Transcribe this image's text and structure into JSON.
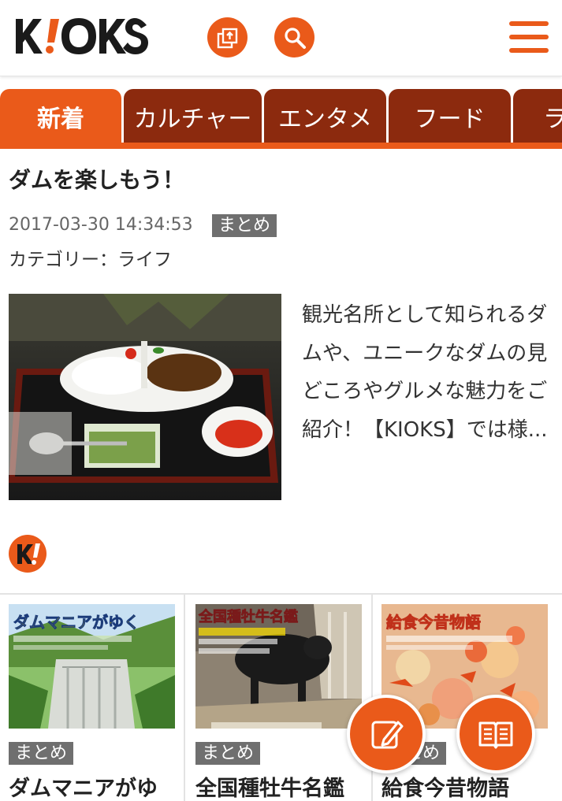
{
  "header": {
    "logo_text": "KIOKS",
    "share_icon": "share-icon",
    "search_icon": "search-icon",
    "menu_icon": "hamburger-menu-icon"
  },
  "colors": {
    "accent": "#ea5a1a",
    "tab_inactive": "#8c2a0e",
    "badge": "#6f6f6f"
  },
  "tabs": [
    {
      "label": "新着",
      "active": true
    },
    {
      "label": "カルチャー",
      "active": false
    },
    {
      "label": "エンタメ",
      "active": false
    },
    {
      "label": "フード",
      "active": false
    },
    {
      "label": "ラ",
      "active": false
    }
  ],
  "article": {
    "title": "ダムを楽しもう！",
    "date": "2017-03-30 14:34:53",
    "badge": "まとめ",
    "category": "カテゴリー：ライフ",
    "excerpt": "観光名所として知られるダムや、ユニークなダムの見どころやグルメな魅力をご紹介！【KIOKS】では様..."
  },
  "cards": [
    {
      "image_caption": "ダムマニアがゆく",
      "badge": "まとめ",
      "title": "ダムマニアがゆ"
    },
    {
      "image_caption": "全国種牡牛名鑑",
      "badge": "まとめ",
      "title": "全国種牡牛名鑑"
    },
    {
      "image_caption": "給食今昔物語",
      "badge": "まとめ",
      "title": "給食今昔物語"
    }
  ],
  "fabs": {
    "write_icon": "edit-icon",
    "read_icon": "book-icon"
  }
}
